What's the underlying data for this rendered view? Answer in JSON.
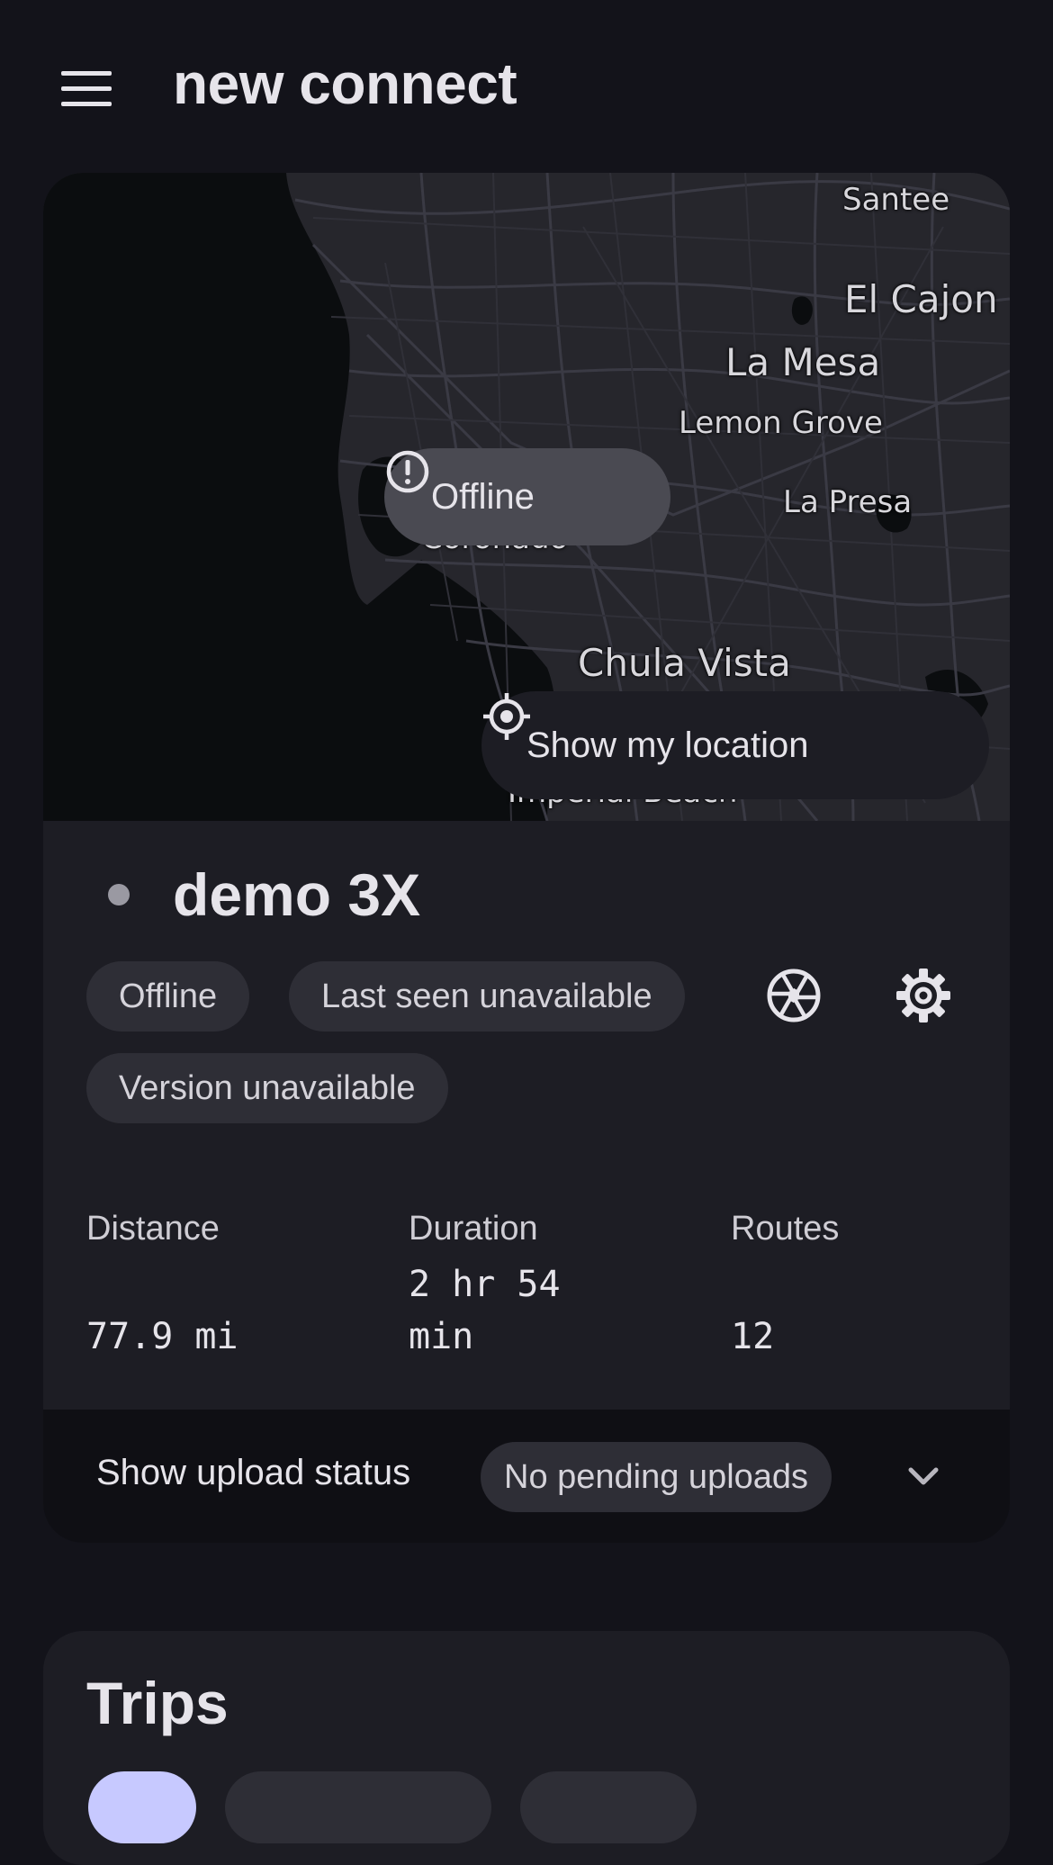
{
  "app": {
    "title": "new connect"
  },
  "map": {
    "labels": [
      "Santee",
      "El Cajon",
      "La Mesa",
      "Lemon Grove",
      "La Presa",
      "Coronado",
      "Chula Vista",
      "Imperial Beach"
    ],
    "offline_label": "Offline",
    "show_location_label": "Show my location"
  },
  "device": {
    "name": "demo 3X",
    "chips": {
      "status": "Offline",
      "last_seen": "Last seen unavailable",
      "version": "Version unavailable"
    }
  },
  "stats": [
    {
      "label": "Distance",
      "value": "77.9 mi"
    },
    {
      "label": "Duration",
      "value": "2 hr 54 min"
    },
    {
      "label": "Routes",
      "value": "12"
    }
  ],
  "upload": {
    "label": "Show upload status",
    "status": "No pending uploads"
  },
  "trips": {
    "title": "Trips"
  },
  "colors": {
    "background": "#13131a",
    "card": "#1d1d24",
    "chip": "#2e2e36",
    "accent": "#c7c9ff"
  },
  "icons": [
    "menu-icon",
    "alert-circle-icon",
    "crosshair-icon",
    "camera-aperture-icon",
    "gear-icon",
    "chevron-down-icon"
  ]
}
